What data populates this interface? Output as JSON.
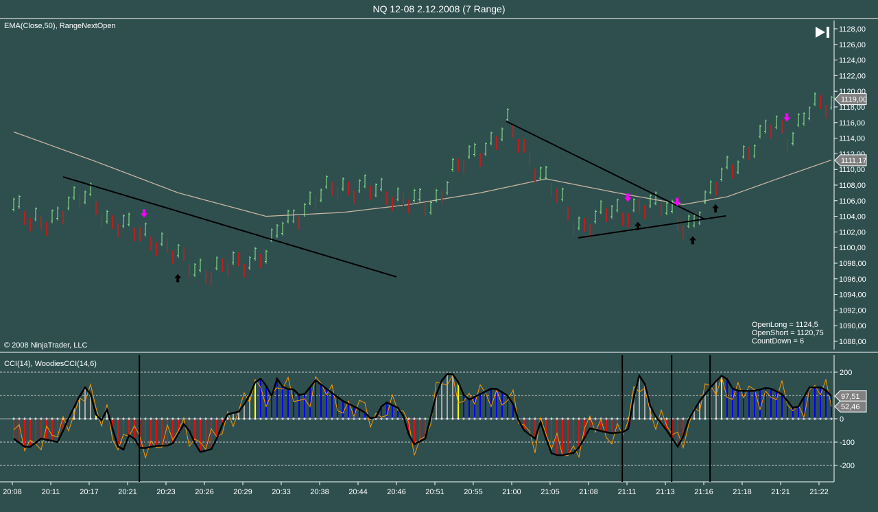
{
  "window_title": "NQ 12-08  2.12.2008 (7 Range)",
  "copyright": "© 2008 NinjaTrader, LLC",
  "colors": {
    "bg": "#2f4f4f",
    "up": "#90ee90",
    "down": "#b22222",
    "ema": "#c8b4a0",
    "cci": "#ff9900",
    "woodies": "#000000",
    "hist_neg": "#dd1111",
    "hist_pos": "#0000ee",
    "hist_neutral": "#aaaaaa",
    "hist_first": "#ffff00",
    "signal_short": "#ff00ff",
    "signal_long": "#000000"
  },
  "chart_data": [
    {
      "type": "bar",
      "name": "price-panel",
      "title": "EMA(Close,50), RangeNextOpen",
      "bar_range": 1.75,
      "ylim": [
        1086.6,
        1129.6
      ],
      "yticks": [
        "1128,00",
        "1126,00",
        "1124,00",
        "1122,00",
        "1120,00",
        "1118,00",
        "1116,00",
        "1114,00",
        "1112,00",
        "1110,00",
        "1108,00",
        "1106,00",
        "1104,00",
        "1102,00",
        "1100,00",
        "1098,00",
        "1096,00",
        "1094,00",
        "1092,00",
        "1090,00",
        "1088,00"
      ],
      "bar_count": 150,
      "price_path": [
        [
          0,
          1105.5
        ],
        [
          3,
          1103
        ],
        [
          7.5,
          1104
        ],
        [
          13.75,
          1107
        ],
        [
          17.5,
          1103
        ],
        [
          23.75,
          1102
        ],
        [
          29.4,
          1099
        ],
        [
          36.25,
          1096.5
        ],
        [
          40,
          1098
        ],
        [
          46.25,
          1099
        ],
        [
          48.75,
          1103
        ],
        [
          53.1,
          1105
        ],
        [
          58.75,
          1108
        ],
        [
          67.5,
          1107
        ],
        [
          72.5,
          1106
        ],
        [
          76.25,
          1105
        ],
        [
          80,
          1110
        ],
        [
          85,
          1112
        ],
        [
          90,
          1116
        ],
        [
          93.75,
          1111
        ],
        [
          97.5,
          1109
        ],
        [
          102.5,
          1102
        ],
        [
          107.5,
          1105
        ],
        [
          111.25,
          1103.5
        ],
        [
          114.4,
          1106
        ],
        [
          117.5,
          1105.5
        ],
        [
          122.5,
          1102.5
        ],
        [
          126.25,
          1106
        ],
        [
          130,
          1110
        ],
        [
          135,
          1113
        ],
        [
          138.75,
          1116
        ],
        [
          141.25,
          1114
        ],
        [
          145,
          1117.5
        ],
        [
          149,
          1118.5
        ]
      ],
      "ema": [
        [
          0,
          1114.8
        ],
        [
          15,
          1111
        ],
        [
          30,
          1107
        ],
        [
          46,
          1104
        ],
        [
          60,
          1104.5
        ],
        [
          72,
          1105.5
        ],
        [
          85,
          1107
        ],
        [
          97,
          1108.8
        ],
        [
          110,
          1107
        ],
        [
          122,
          1105.5
        ],
        [
          130,
          1106.5
        ],
        [
          140,
          1109
        ],
        [
          149,
          1111.2
        ]
      ],
      "trendlines": [
        [
          [
            9,
            1109.05
          ],
          [
            69.75,
            1096.25
          ]
        ],
        [
          [
            89.75,
            1116.16
          ],
          [
            126,
            1103.6
          ]
        ],
        [
          [
            102.9,
            1101.25
          ],
          [
            129.75,
            1104.05
          ]
        ]
      ],
      "short_signals": [
        23.75,
        111.9,
        120.9,
        140.9
      ],
      "long_signals": [
        29.9,
        113.75,
        123.75,
        127.9
      ],
      "last_price": "1119,00",
      "last_price_value": 1119,
      "ema_value": "1111,17",
      "ema_last": 1111.17,
      "readouts": [
        "OpenLong = 1124,5",
        "OpenShort = 1120,75",
        "CountDown = 6"
      ]
    },
    {
      "type": "line",
      "name": "cci-panel",
      "title": "CCI(14), WoodiesCCI(14,6)",
      "ylim": [
        -260,
        260
      ],
      "yticks": [
        {
          "v": 200,
          "t": "200"
        },
        {
          "v": 0,
          "t": "0"
        },
        {
          "v": -100,
          "t": "-100"
        },
        {
          "v": -200,
          "t": "-200"
        }
      ],
      "gridlines": [
        200,
        100,
        -100,
        -200
      ],
      "woodies": [
        [
          0,
          -85
        ],
        [
          2.5,
          -129
        ],
        [
          5,
          -85
        ],
        [
          8.1,
          -100
        ],
        [
          10,
          3
        ],
        [
          12.5,
          120
        ],
        [
          13.5,
          150
        ],
        [
          15,
          18
        ],
        [
          16.25,
          -12
        ],
        [
          17.1,
          47
        ],
        [
          18.75,
          -115
        ],
        [
          20,
          -132
        ],
        [
          21.25,
          -56
        ],
        [
          23.1,
          -129
        ],
        [
          26.25,
          -115
        ],
        [
          28.75,
          -115
        ],
        [
          31.25,
          -12
        ],
        [
          33.75,
          -144
        ],
        [
          36.25,
          -129
        ],
        [
          38.75,
          18
        ],
        [
          41.25,
          32
        ],
        [
          43.1,
          106
        ],
        [
          44.4,
          179
        ],
        [
          45.6,
          165
        ],
        [
          46.9,
          91
        ],
        [
          48.1,
          179
        ],
        [
          49.4,
          120
        ],
        [
          50.6,
          135
        ],
        [
          52.5,
          91
        ],
        [
          55,
          165
        ],
        [
          57.5,
          120
        ],
        [
          60,
          76
        ],
        [
          63.75,
          32
        ],
        [
          65.6,
          -12
        ],
        [
          67.5,
          76
        ],
        [
          70,
          47
        ],
        [
          71.25,
          3
        ],
        [
          72.5,
          -115
        ],
        [
          75,
          -85
        ],
        [
          77.5,
          150
        ],
        [
          79.4,
          203
        ],
        [
          80.6,
          179
        ],
        [
          82.5,
          76
        ],
        [
          85,
          106
        ],
        [
          87.5,
          135
        ],
        [
          90.6,
          91
        ],
        [
          92.5,
          -41
        ],
        [
          95,
          -85
        ],
        [
          96.25,
          3
        ],
        [
          97.5,
          -144
        ],
        [
          99.4,
          -159
        ],
        [
          102.5,
          -144
        ],
        [
          105,
          -41
        ],
        [
          108.75,
          -62
        ],
        [
          111.9,
          -56
        ],
        [
          113.75,
          194
        ],
        [
          115,
          150
        ],
        [
          116.25,
          32
        ],
        [
          118.75,
          -41
        ],
        [
          121.25,
          -129
        ],
        [
          123.1,
          3
        ],
        [
          125,
          76
        ],
        [
          127.5,
          150
        ],
        [
          129.4,
          194
        ],
        [
          131.25,
          120
        ],
        [
          135,
          120
        ],
        [
          137.5,
          135
        ],
        [
          140,
          106
        ],
        [
          142.5,
          32
        ],
        [
          145,
          135
        ],
        [
          147.5,
          135
        ],
        [
          149,
          97.51
        ]
      ],
      "woodies_value": "97,51",
      "cci_value": "52,46",
      "cci_last": 52.46,
      "vertical_markers": [
        22.9,
        110.9,
        119.9,
        126.9
      ]
    }
  ],
  "x_labels": [
    "20:08",
    "20:11",
    "20:17",
    "20:21",
    "20:23",
    "20:26",
    "20:29",
    "20:33",
    "20:38",
    "20:44",
    "20:46",
    "20:51",
    "20:55",
    "21:00",
    "21:05",
    "21:08",
    "21:11",
    "21:13",
    "21:16",
    "21:18",
    "21:21",
    "21:22"
  ]
}
